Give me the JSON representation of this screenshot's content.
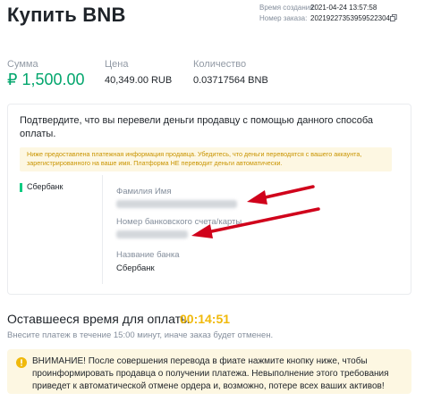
{
  "header": {
    "title": "Купить BNB",
    "created_label": "Время создания:",
    "created_value": "2021-04-24 13:57:58",
    "order_label": "Номер заказа:",
    "order_value": "20219227353959522304"
  },
  "summary": {
    "amount_label": "Сумма",
    "amount_value": "₽ 1,500.00",
    "price_label": "Цена",
    "price_value": "40,349.00 RUB",
    "qty_label": "Количество",
    "qty_value": "0.03717564 BNB"
  },
  "payment": {
    "confirm_text": "Подтвердите, что вы перевели деньги продавцу с помощью данного способа оплаты.",
    "notice_text": "Ниже предоставлена платежная информация продавца. Убедитесь, что деньги переводятся с вашего аккаунта, зарегистрированного на ваше имя. Платформа НЕ переводит деньги автоматически.",
    "method_tab": "Сбербанк",
    "name_label": "Фамилия Имя",
    "account_label": "Номер банковского счета/карты",
    "bank_label": "Название банка",
    "bank_value": "Сбербанк"
  },
  "timer": {
    "label": "Оставшееся время для оплаты",
    "value": "00:14:51",
    "sub": "Внесите платеж в течение 15:00 минут, иначе заказ будет отменен."
  },
  "warning": {
    "text": "ВНИМАНИЕ! После совершения перевода в фиате нажмите кнопку ниже, чтобы проинформировать продавца о получении платежа. Невыполнение этого требования приведет к автоматической отмене ордера и, возможно, потере всех ваших активов!"
  },
  "colors": {
    "accent_green": "#0ecb81",
    "amount_green": "#03a66d",
    "timer_yellow": "#f0b90b",
    "annotation_red": "#d0021b"
  },
  "icons": {
    "copy": "copy-icon",
    "warning": "warning-icon",
    "annotation_arrow": "red-arrow"
  }
}
